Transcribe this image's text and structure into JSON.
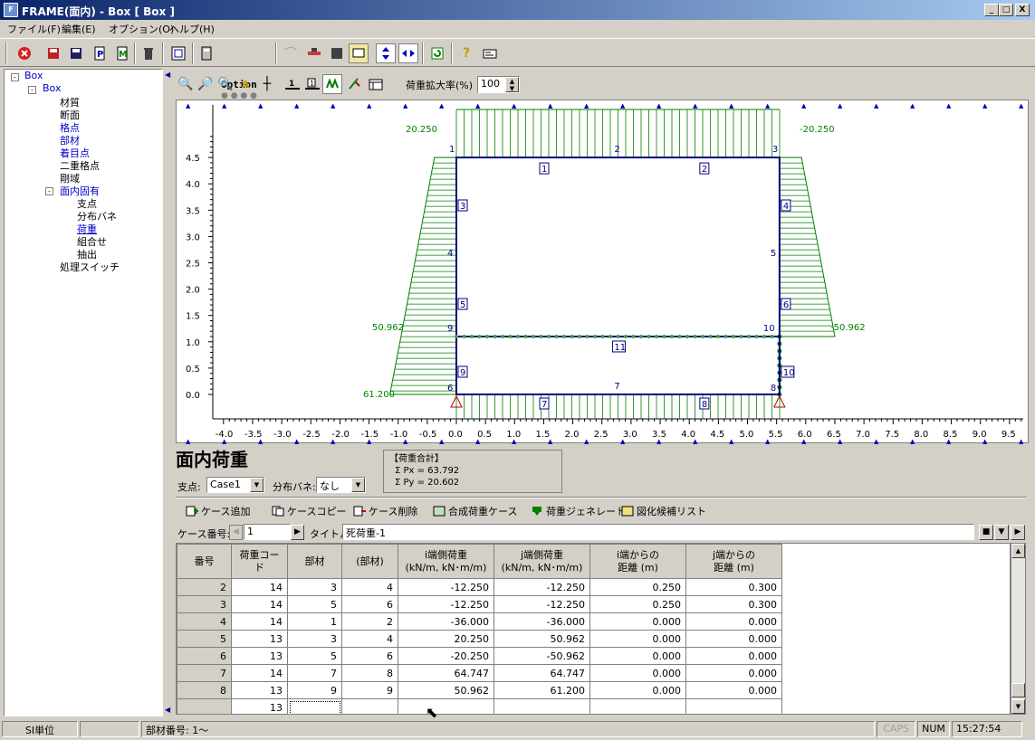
{
  "window": {
    "title": "FRAME(面内) - Box [ Box ]",
    "min": "_",
    "max": "□",
    "close": "X"
  },
  "menu": [
    "ファイル(F)",
    "編集(E)",
    "オプション(O)",
    "ヘルプ(H)"
  ],
  "toolbar": {
    "option_label": "Option"
  },
  "tree": {
    "root": "Box",
    "child": "Box",
    "items": [
      "材質",
      "断面",
      "格点",
      "部材",
      "着目点",
      "二重格点",
      "剛域",
      "面内固有",
      "支点",
      "分布バネ",
      "荷重",
      "組合せ",
      "抽出",
      "処理スイッチ"
    ]
  },
  "canvas_toolbar": {
    "zoom_label": "荷重拡大率(%)",
    "zoom_value": "100"
  },
  "plot": {
    "y_ticks": [
      "4.5",
      "4.0",
      "3.5",
      "3.0",
      "2.5",
      "2.0",
      "1.5",
      "1.0",
      "0.5",
      "0.0"
    ],
    "x_ticks": [
      "-4.0",
      "-3.5",
      "-3.0",
      "-2.5",
      "-2.0",
      "-1.5",
      "-1.0",
      "-0.5",
      "0.0",
      "0.5",
      "1.0",
      "1.5",
      "2.0",
      "2.5",
      "3.0",
      "3.5",
      "4.0",
      "4.5",
      "5.0",
      "5.5",
      "6.0",
      "6.5",
      "7.0",
      "7.5",
      "8.0",
      "8.5",
      "9.0",
      "9.5"
    ],
    "load_labels": {
      "tl": "20.250",
      "tr": "-20.250",
      "ml": "50.962",
      "mr": "-50.962",
      "bl": "61.200"
    },
    "node_labels": [
      "1",
      "2",
      "3",
      "4",
      "5",
      "9",
      "10",
      "6",
      "7",
      "8"
    ],
    "member_labels": [
      "1",
      "2",
      "3",
      "4",
      "5",
      "6",
      "9",
      "10",
      "11",
      "7",
      "8"
    ]
  },
  "panel": {
    "title": "面内荷重",
    "support_label": "支点:",
    "support_value": "Case1",
    "spring_label": "分布バネ:",
    "spring_value": "なし"
  },
  "summary": {
    "title": "【荷重合計】",
    "px": "Σ Px = 63.792",
    "py": "Σ Py = 20.602"
  },
  "actions": [
    "ケース追加",
    "ケースコピー",
    "ケース削除",
    "合成荷重ケース",
    "荷重ジェネレート",
    "図化候補リスト"
  ],
  "case": {
    "label": "ケース番号:",
    "value": "1",
    "title_label": "タイトル:",
    "title_value": "死荷重-1"
  },
  "table": {
    "headers": [
      "番号",
      "荷重コード",
      "部材",
      "(部材)",
      "i端側荷重\n(kN/m, kN･m/m)",
      "j端側荷重\n(kN/m, kN･m/m)",
      "i端からの\n距離 (m)",
      "j端からの\n距離 (m)"
    ],
    "rows": [
      [
        "2",
        "14",
        "3",
        "4",
        "-12.250",
        "-12.250",
        "0.250",
        "0.300"
      ],
      [
        "3",
        "14",
        "5",
        "6",
        "-12.250",
        "-12.250",
        "0.250",
        "0.300"
      ],
      [
        "4",
        "14",
        "1",
        "2",
        "-36.000",
        "-36.000",
        "0.000",
        "0.000"
      ],
      [
        "5",
        "13",
        "3",
        "4",
        "20.250",
        "50.962",
        "0.000",
        "0.000"
      ],
      [
        "6",
        "13",
        "5",
        "6",
        "-20.250",
        "-50.962",
        "0.000",
        "0.000"
      ],
      [
        "7",
        "14",
        "7",
        "8",
        "64.747",
        "64.747",
        "0.000",
        "0.000"
      ],
      [
        "8",
        "13",
        "9",
        "9",
        "50.962",
        "61.200",
        "0.000",
        "0.000"
      ],
      [
        "",
        "13",
        "",
        "",
        "",
        "",
        "",
        ""
      ]
    ]
  },
  "status": {
    "unit": "SI単位",
    "member": "部材番号: 1～",
    "caps": "CAPS",
    "num": "NUM",
    "time": "15:27:54"
  }
}
